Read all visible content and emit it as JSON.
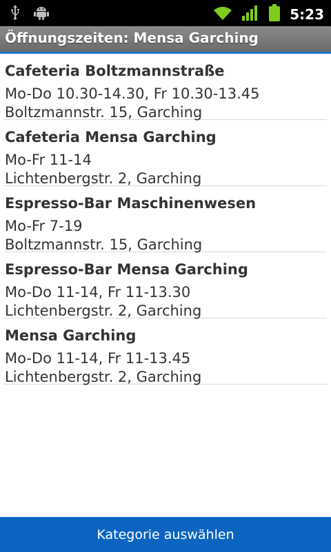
{
  "status_bar": {
    "time": "5:23",
    "icons": [
      "usb-icon",
      "android-debug-icon",
      "wifi-icon",
      "signal-icon",
      "battery-icon"
    ]
  },
  "title_bar": {
    "title": "Öffnungszeiten: Mensa Garching"
  },
  "locations": [
    {
      "name": "Cafeteria Boltzmannstraße",
      "hours": "Mo-Do 10.30-14.30, Fr 10.30-13.45",
      "address": "Boltzmannstr. 15, Garching"
    },
    {
      "name": "Cafeteria Mensa Garching",
      "hours": "Mo-Fr 11-14",
      "address": "Lichtenbergstr. 2, Garching"
    },
    {
      "name": "Espresso-Bar Maschinenwesen",
      "hours": "Mo-Fr 7-19",
      "address": "Boltzmannstr. 15, Garching"
    },
    {
      "name": "Espresso-Bar Mensa Garching",
      "hours": "Mo-Do 11-14, Fr 11-13.30",
      "address": "Lichtenbergstr. 2, Garching"
    },
    {
      "name": "Mensa Garching",
      "hours": "Mo-Do 11-14, Fr 11-13.45",
      "address": "Lichtenbergstr. 2, Garching"
    }
  ],
  "bottom_button": {
    "label": "Kategorie auswählen"
  },
  "colors": {
    "accent": "#1f76c9",
    "button": "#0b64c0",
    "battery": "#7fcc1e",
    "signal": "#7fcc1e"
  }
}
